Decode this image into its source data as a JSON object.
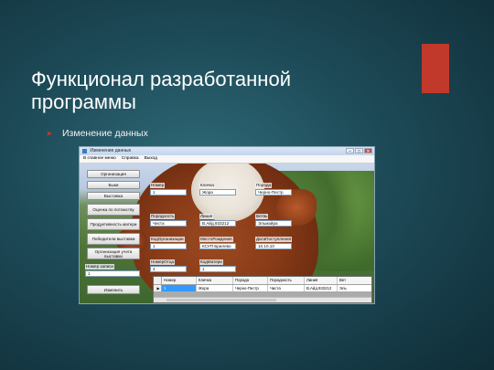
{
  "slide": {
    "title_line1": "Функционал разработанной",
    "title_line2": "программы",
    "bullet": "Изменение данных",
    "accent_color": "#c0392b"
  },
  "window": {
    "title": "Изменение данных",
    "controls": [
      "–",
      "□",
      "✕"
    ],
    "menu": [
      "В главное меню",
      "Справка",
      "Выход"
    ]
  },
  "sidebar": {
    "buttons": [
      "Организация",
      "Быки",
      "Выставка",
      "Оценка по потомству",
      "Продуктивность матери",
      "Победители выставки",
      "Организация учета выставки"
    ],
    "bull_number_label": "Номер записи",
    "bull_number_value": "1",
    "change_button": "Изменить"
  },
  "form": {
    "nomer_label": "Номер",
    "nomer_value": "1",
    "klichka_label": "Кличка",
    "klichka_value": "Жора",
    "poroda_label": "Порода",
    "poroda_value": "Черно-Пестр",
    "porodnost_label": "Породность",
    "porodnost_value": "Чиста",
    "linia_label": "Линия",
    "linia_value": "В.Айд.933212",
    "vet_label": "Ветвь",
    "vet_value": "Эльмайра",
    "kod_org_label": "КодОрганизации",
    "kod_org_value": "1",
    "mesto_label": "МестоРождения",
    "mesto_value": "КСУП Брилево",
    "data_label": "ДатаПоступления",
    "data_value": "10.10.10",
    "nomer_otca_label": "НомерОтца",
    "nomer_otca_value": "4",
    "kod_materi_label": "КодМатери",
    "kod_materi_value": "1"
  },
  "grid": {
    "columns": [
      "Номер",
      "Кличка",
      "Порода",
      "Породность",
      "Линия",
      "Вет"
    ],
    "rows": [
      [
        "1",
        "Жора",
        "Черно-Пестр",
        "Чиста",
        "В.Айд.933212",
        "Эль"
      ]
    ],
    "row_marker": "▶"
  }
}
